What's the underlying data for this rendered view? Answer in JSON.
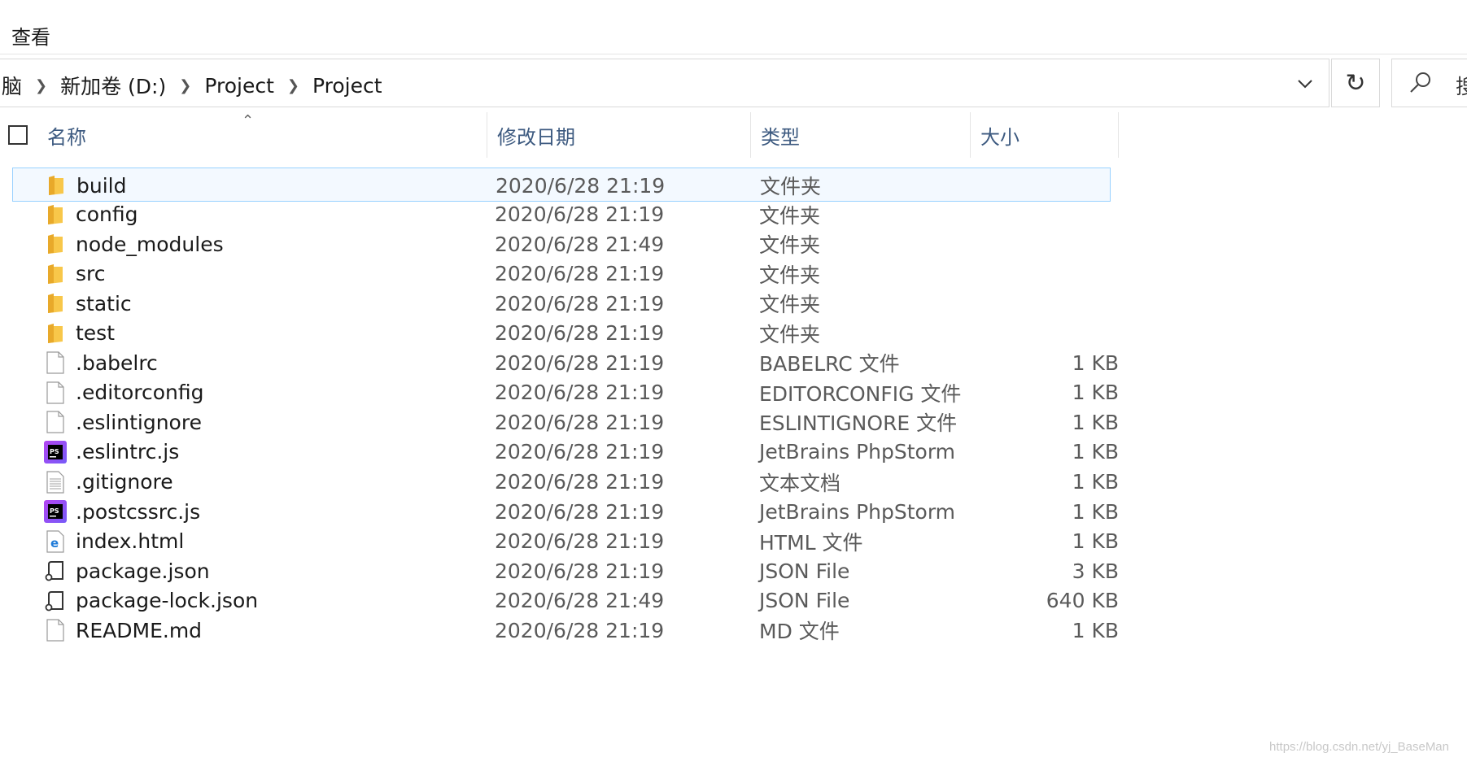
{
  "ribbon": {
    "view_tab": "查看"
  },
  "address": {
    "crumbs": [
      "脑",
      "新加卷 (D:)",
      "Project",
      "Project"
    ],
    "search_placeholder": "搜"
  },
  "header": {
    "name": "名称",
    "date": "修改日期",
    "type": "类型",
    "size": "大小"
  },
  "rows": [
    {
      "icon": "folder-icon",
      "name": "build",
      "date": "2020/6/28 21:19",
      "type": "文件夹",
      "size": ""
    },
    {
      "icon": "folder-icon",
      "name": "config",
      "date": "2020/6/28 21:19",
      "type": "文件夹",
      "size": ""
    },
    {
      "icon": "folder-icon",
      "name": "node_modules",
      "date": "2020/6/28 21:49",
      "type": "文件夹",
      "size": ""
    },
    {
      "icon": "folder-icon",
      "name": "src",
      "date": "2020/6/28 21:19",
      "type": "文件夹",
      "size": ""
    },
    {
      "icon": "folder-icon",
      "name": "static",
      "date": "2020/6/28 21:19",
      "type": "文件夹",
      "size": ""
    },
    {
      "icon": "folder-icon",
      "name": "test",
      "date": "2020/6/28 21:19",
      "type": "文件夹",
      "size": ""
    },
    {
      "icon": "blank-file-icon",
      "name": ".babelrc",
      "date": "2020/6/28 21:19",
      "type": "BABELRC 文件",
      "size": "1 KB"
    },
    {
      "icon": "blank-file-icon",
      "name": ".editorconfig",
      "date": "2020/6/28 21:19",
      "type": "EDITORCONFIG 文件",
      "size": "1 KB"
    },
    {
      "icon": "blank-file-icon",
      "name": ".eslintignore",
      "date": "2020/6/28 21:19",
      "type": "ESLINTIGNORE 文件",
      "size": "1 KB"
    },
    {
      "icon": "phpstorm-icon",
      "name": ".eslintrc.js",
      "date": "2020/6/28 21:19",
      "type": "JetBrains PhpStorm",
      "size": "1 KB"
    },
    {
      "icon": "text-file-icon",
      "name": ".gitignore",
      "date": "2020/6/28 21:19",
      "type": "文本文档",
      "size": "1 KB"
    },
    {
      "icon": "phpstorm-icon",
      "name": ".postcssrc.js",
      "date": "2020/6/28 21:19",
      "type": "JetBrains PhpStorm",
      "size": "1 KB"
    },
    {
      "icon": "edge-html-icon",
      "name": "index.html",
      "date": "2020/6/28 21:19",
      "type": "HTML 文件",
      "size": "1 KB"
    },
    {
      "icon": "json-file-icon",
      "name": "package.json",
      "date": "2020/6/28 21:19",
      "type": "JSON File",
      "size": "3 KB"
    },
    {
      "icon": "json-file-icon",
      "name": "package-lock.json",
      "date": "2020/6/28 21:49",
      "type": "JSON File",
      "size": "640 KB"
    },
    {
      "icon": "blank-file-icon",
      "name": "README.md",
      "date": "2020/6/28 21:19",
      "type": "MD 文件",
      "size": "1 KB"
    }
  ],
  "watermark": "https://blog.csdn.net/yj_BaseMan",
  "colors": {
    "folder": "#f8c74a",
    "selection_border": "#99d1ff",
    "header_text": "#3d5a80",
    "phpstorm": "#b345f1"
  }
}
